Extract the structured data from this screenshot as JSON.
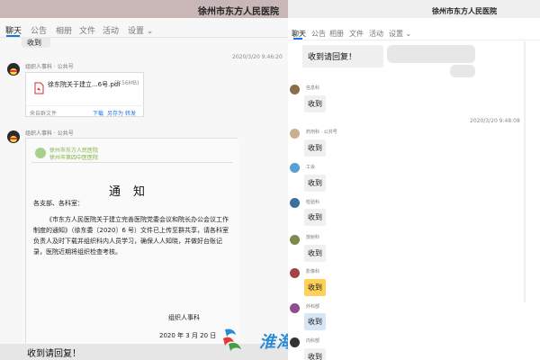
{
  "left": {
    "title": "徐州市东方人民医院",
    "tabs": [
      "聊天",
      "公告",
      "相册",
      "文件",
      "活动",
      "设置 ⌄"
    ],
    "top_bubble": "收到",
    "file_message": {
      "timestamp": "2020/3/20 9:46:20",
      "sender": "组织人事科 · 公共号",
      "file_name": "徐东院关于建立...6号.pdf",
      "file_size": "(5.56MB)",
      "source": "来自群文件",
      "actions": [
        "下载",
        "另存为",
        "转发"
      ]
    },
    "notice_message": {
      "sender": "组织人事科 · 公共号",
      "logo_line1": "徐州市东方人民医院",
      "logo_line2": "徐州市第四中医医院",
      "title": "通知",
      "greeting": "各支部、各科室：",
      "body": "《市东方人民医院关于建立完善医院党委会议和院长办公会议工作制度的通知》（徐东委〔2020〕6 号）文件已上传至群共享，请各科室负责人及时下载并组织科内人员学习，确保人人知晓，并做好台账记录，医院近期将组织检查考核。",
      "signature": "组织人事科",
      "date": "2020 年 3 月 20 日"
    },
    "bottom_text": "收到请回复！"
  },
  "right": {
    "title": "徐州市东方人民医院",
    "tabs": [
      "聊天",
      "公告",
      "相册",
      "文件",
      "活动",
      "设置 ⌄"
    ],
    "top_message": "收到请回复！",
    "timestamp": "2020/3/20 9:48:08",
    "messages": [
      {
        "sender": "信息科",
        "text": "收到",
        "style": "gray",
        "avatar_color": "#8a6e4b"
      },
      {
        "sender": "药剂科 · 公共号",
        "text": "收到",
        "style": "gray",
        "avatar_color": "#c9b08e"
      },
      {
        "sender": "工会",
        "text": "收到",
        "style": "gray",
        "avatar_color": "#5a9fd4"
      },
      {
        "sender": "检验科",
        "text": "收到",
        "style": "gray",
        "avatar_color": "#3c6e9e"
      },
      {
        "sender": "放射科",
        "text": "收到",
        "style": "gray",
        "avatar_color": "#7a8b4d"
      },
      {
        "sender": "影像科",
        "text": "收到",
        "style": "yellow",
        "avatar_color": "#a04545"
      },
      {
        "sender": "外科部",
        "text": "收到",
        "style": "blue",
        "avatar_color": "#8e4d8e"
      },
      {
        "sender": "内科部",
        "text": "收到",
        "style": "gray",
        "avatar_color": "#333333"
      }
    ]
  },
  "watermark": {
    "text": "淮海名医网"
  }
}
